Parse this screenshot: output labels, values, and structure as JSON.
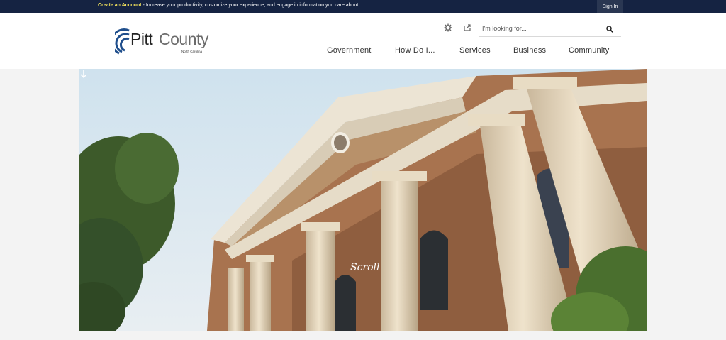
{
  "topbar": {
    "create_account_link": "Create an Account",
    "message": " - Increase your productivity, customize your experience, and engage in information you care about.",
    "sign_in_label": "Sign In"
  },
  "logo": {
    "word_pitt": "Pitt",
    "word_county": "County",
    "subtitle": "North Carolina"
  },
  "tools": {
    "settings_icon": "gear-icon",
    "share_icon": "share-icon"
  },
  "search": {
    "placeholder": "I'm looking for...",
    "icon": "search-icon"
  },
  "nav": {
    "items": [
      "Government",
      "How Do I...",
      "Services",
      "Business",
      "Community"
    ]
  },
  "hero": {
    "scroll_label": "Scroll",
    "scroll_icon": "arrow-down-icon"
  },
  "colors": {
    "topbar_bg": "#152342",
    "accent_link": "#f1e15b",
    "logo_blue": "#1f4e8c"
  }
}
